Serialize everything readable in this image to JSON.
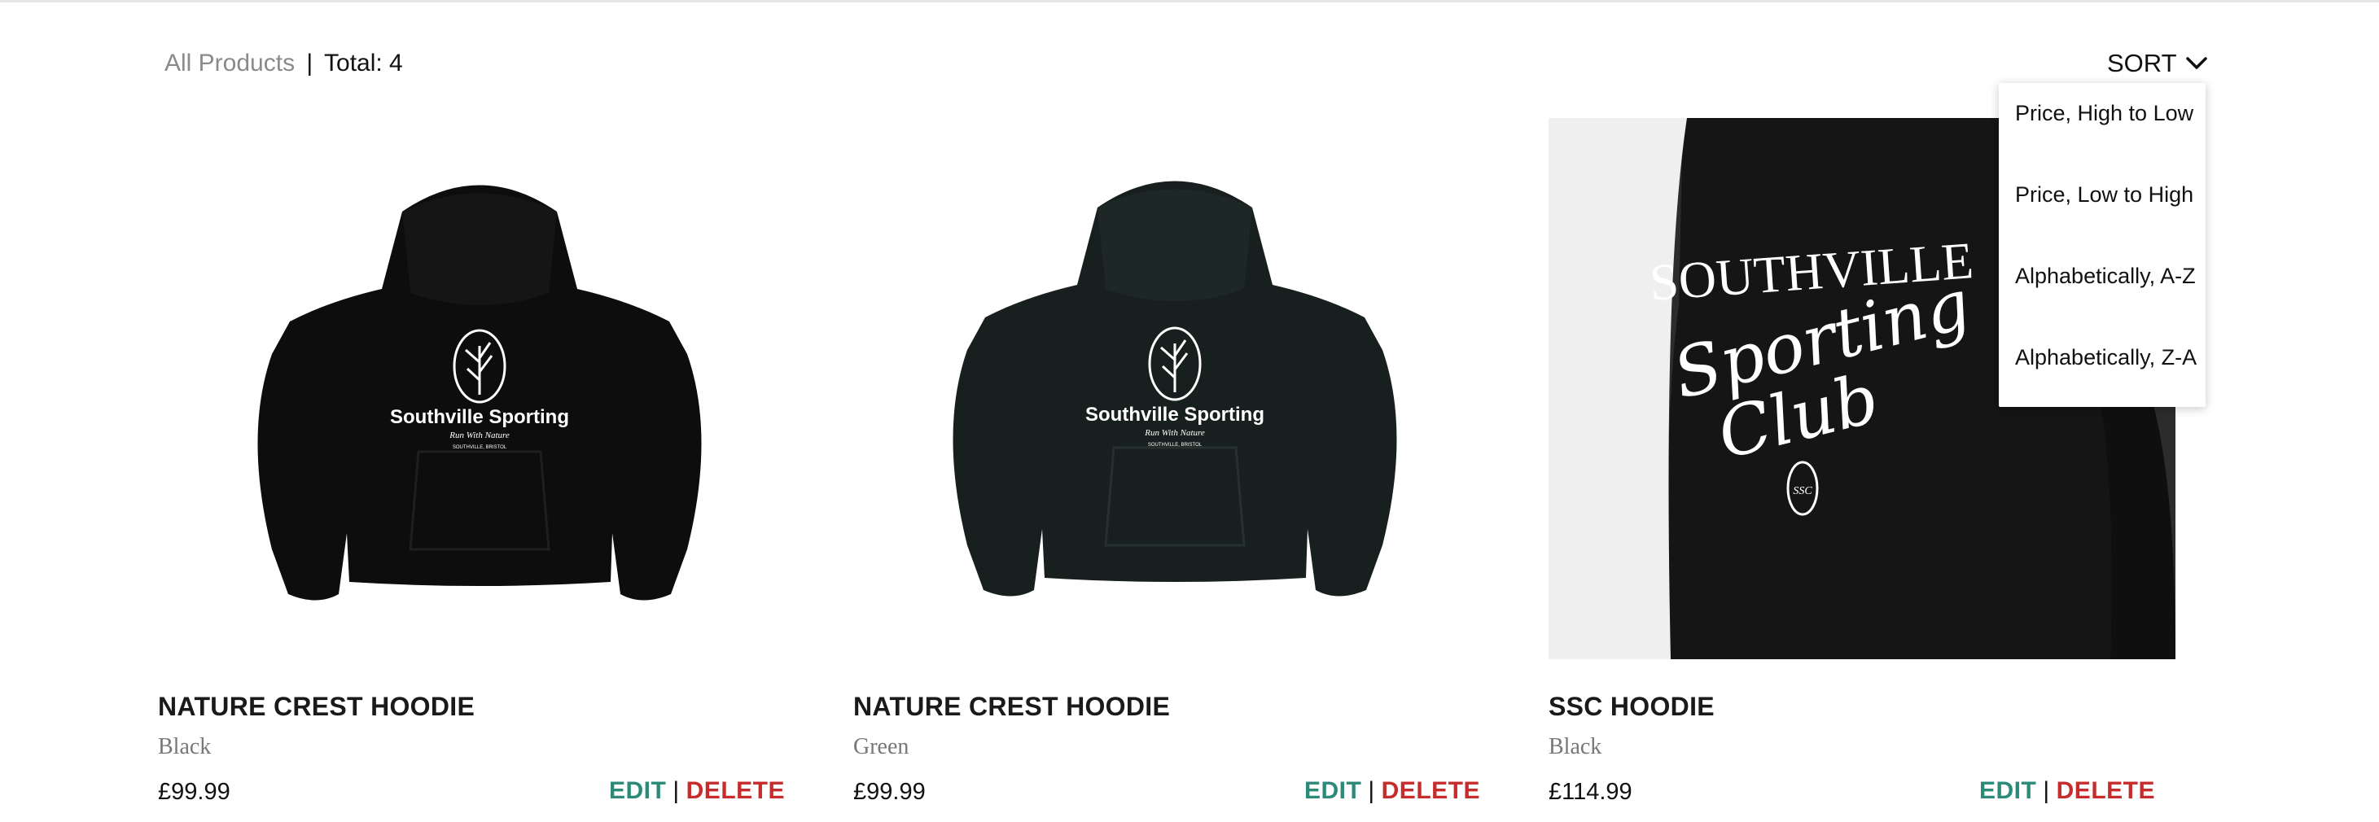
{
  "header": {
    "section_label": "All Products",
    "separator": "|",
    "total_label": "Total: 4"
  },
  "sort": {
    "label": "SORT",
    "icon": "chevron-down-icon",
    "options": [
      "Price, High to Low",
      "Price, Low to High",
      "Alphabetically, A-Z",
      "Alphabetically, Z-A"
    ]
  },
  "products": [
    {
      "name": "NATURE CREST HOODIE",
      "color": "Black",
      "price": "£99.99",
      "image": {
        "hoodie_color": "#0d0d0d",
        "print_main": "Southville Sporting",
        "print_script": "Run With Nature",
        "print_small": "SOUTHVILLE, BRISTOL"
      },
      "edit_label": "EDIT",
      "separator": "|",
      "delete_label": "DELETE"
    },
    {
      "name": "NATURE CREST HOODIE",
      "color": "Green",
      "price": "£99.99",
      "image": {
        "hoodie_color": "#17201e",
        "print_main": "Southville Sporting",
        "print_script": "Run With Nature",
        "print_small": "SOUTHVILLE, BRISTOL"
      },
      "edit_label": "EDIT",
      "separator": "|",
      "delete_label": "DELETE"
    },
    {
      "name": "SSC HOODIE",
      "color": "Black",
      "price": "£114.99",
      "image": {
        "hoodie_color": "#1a1a1a",
        "print_main": "SOUTHVILLE",
        "print_script_1": "Sporting",
        "print_script_2": "Club",
        "print_badge": "SSC"
      },
      "edit_label": "EDIT",
      "separator": "|",
      "delete_label": "DELETE"
    }
  ],
  "colors": {
    "edit": "#2c8a78",
    "delete": "#c62c2c",
    "muted": "#8a8a8a"
  }
}
